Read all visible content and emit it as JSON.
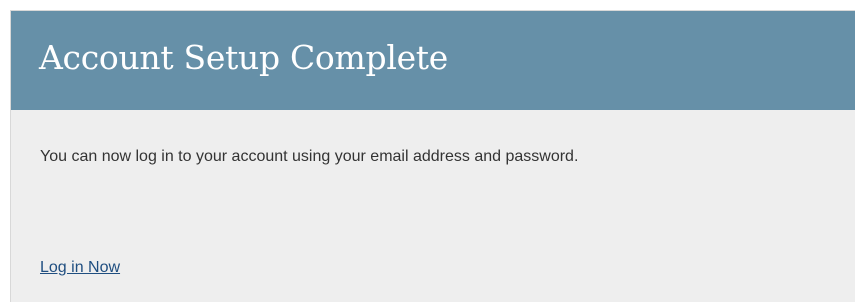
{
  "header": {
    "title": "Account Setup Complete",
    "background_color": "#6690a8"
  },
  "main": {
    "message": "You can now log in to your account using your email address and password.",
    "login_link_label": "Log in Now",
    "link_color": "#1f4e80"
  }
}
